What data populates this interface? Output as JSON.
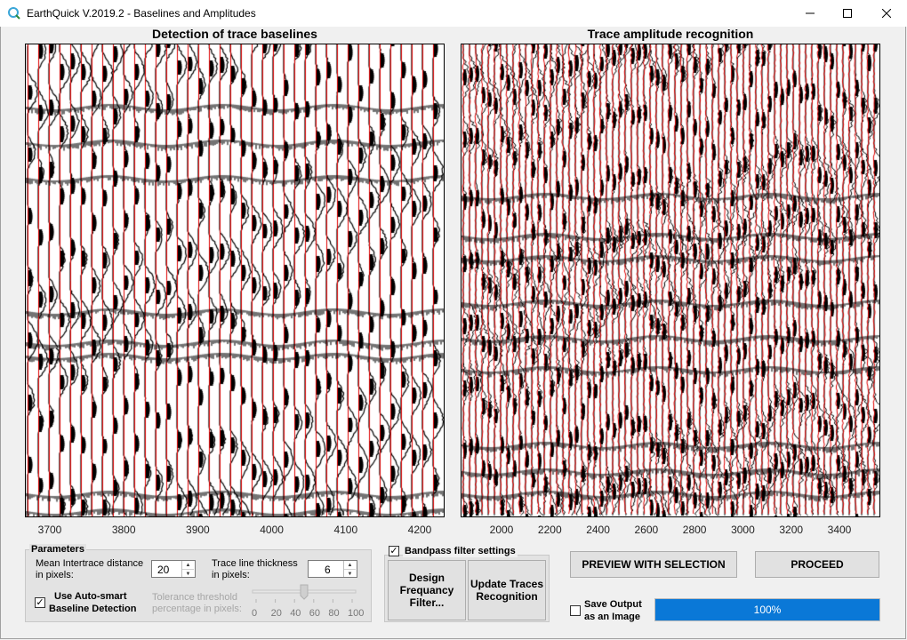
{
  "window": {
    "title": "EarthQuick V.2019.2 - Baselines and Amplitudes",
    "app_icon": "earthquick-q-icon",
    "controls": [
      "minimize-icon",
      "maximize-icon",
      "close-icon"
    ]
  },
  "left_plot": {
    "title": "Detection of trace baselines",
    "x_ticks": [
      "3700",
      "3800",
      "3900",
      "4000",
      "4100",
      "4200"
    ]
  },
  "right_plot": {
    "title": "Trace amplitude recognition",
    "x_ticks": [
      "2000",
      "2200",
      "2400",
      "2600",
      "2800",
      "3000",
      "3200",
      "3400"
    ]
  },
  "parameters": {
    "legend": "Parameters",
    "intertrace_label_1": "Mean Intertrace distance",
    "intertrace_label_2": "in pixels:",
    "intertrace_value": "20",
    "thickness_label_1": "Trace line thickness",
    "thickness_label_2": "in pixels:",
    "thickness_value": "6",
    "autosmart_label_1": "Use Auto-smart",
    "autosmart_label_2": "Baseline Detection",
    "autosmart_checked": true,
    "tolerance_label_1": "Tolerance threshold",
    "tolerance_label_2": "percentage in pixels:",
    "tolerance_value": 50,
    "slider_ticks": [
      "0",
      "20",
      "40",
      "60",
      "80",
      "100"
    ]
  },
  "bandpass": {
    "checkbox_label": "Bandpass filter settings",
    "checked": true,
    "design_line_1": "Design",
    "design_line_2": "Frequancy",
    "design_line_3": "Filter...",
    "update_line_1": "Update Traces",
    "update_line_2": "Recognition"
  },
  "actions": {
    "preview_label": "PREVIEW WITH SELECTION",
    "proceed_label": "PROCEED",
    "save_label_1": "Save Output",
    "save_label_2": "as an Image",
    "save_checked": false,
    "progress_text": "100%",
    "progress_value": 100
  },
  "colors": {
    "baseline": "#e00000",
    "progress": "#0a78d7"
  }
}
